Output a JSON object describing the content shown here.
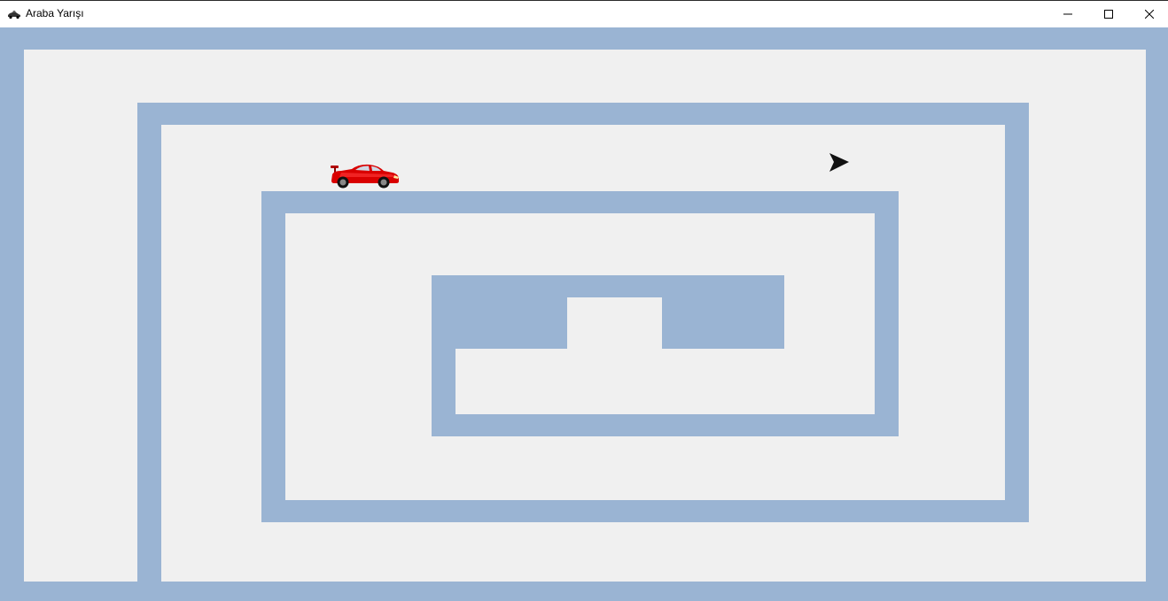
{
  "window": {
    "title": "Araba Yarışı",
    "icon": "race-car-icon",
    "controls": {
      "minimize_icon": "minimize-icon",
      "maximize_icon": "maximize-icon",
      "close_icon": "close-icon"
    }
  },
  "game": {
    "player": "red-sports-car",
    "finish_marker": "arrow-cursor-icon"
  },
  "colors": {
    "wall": "#9ab4d3",
    "track": "#f0f0f0",
    "car": "#d90000",
    "arrow": "#111111"
  }
}
